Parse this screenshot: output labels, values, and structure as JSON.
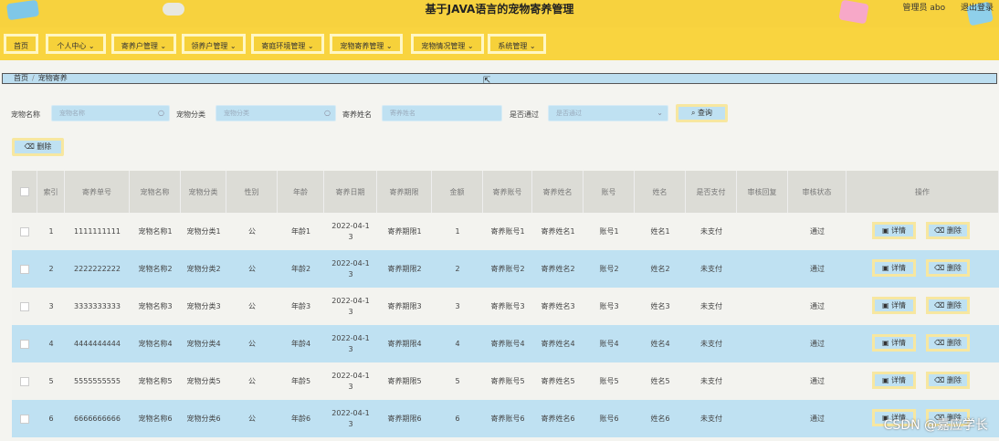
{
  "header": {
    "title": "基于JAVA语言的宠物寄养管理",
    "user": "管理员 abo",
    "logout": "退出登录"
  },
  "nav": [
    "首页",
    "个人中心",
    "寄养户管理",
    "领养户管理",
    "寄庭环境管理",
    "宠物寄养管理",
    "宠物情况管理",
    "系统管理"
  ],
  "breadcrumb": {
    "home": "首页",
    "sep": "/",
    "current": "宠物寄养"
  },
  "search": {
    "fields": [
      {
        "label": "宠物名称",
        "placeholder": "宠物名称"
      },
      {
        "label": "宠物分类",
        "placeholder": "宠物分类"
      },
      {
        "label": "寄养姓名",
        "placeholder": "寄养姓名"
      },
      {
        "label": "是否通过",
        "placeholder": "是否通过"
      }
    ],
    "query_label": "查询",
    "delete_label": "删除"
  },
  "table": {
    "headers": [
      "索引",
      "寄养单号",
      "宠物名称",
      "宠物分类",
      "性别",
      "年龄",
      "寄养日期",
      "寄养期限",
      "金额",
      "寄养账号",
      "寄养姓名",
      "账号",
      "姓名",
      "是否支付",
      "审核回复",
      "审核状态",
      "操作"
    ],
    "rows": [
      [
        "1",
        "1111111111",
        "宠物名称1",
        "宠物分类1",
        "公",
        "年龄1",
        "2022-04-13",
        "寄养期限1",
        "1",
        "寄养账号1",
        "寄养姓名1",
        "账号1",
        "姓名1",
        "未支付",
        "",
        "通过"
      ],
      [
        "2",
        "2222222222",
        "宠物名称2",
        "宠物分类2",
        "公",
        "年龄2",
        "2022-04-13",
        "寄养期限2",
        "2",
        "寄养账号2",
        "寄养姓名2",
        "账号2",
        "姓名2",
        "未支付",
        "",
        "通过"
      ],
      [
        "3",
        "3333333333",
        "宠物名称3",
        "宠物分类3",
        "公",
        "年龄3",
        "2022-04-13",
        "寄养期限3",
        "3",
        "寄养账号3",
        "寄养姓名3",
        "账号3",
        "姓名3",
        "未支付",
        "",
        "通过"
      ],
      [
        "4",
        "4444444444",
        "宠物名称4",
        "宠物分类4",
        "公",
        "年龄4",
        "2022-04-13",
        "寄养期限4",
        "4",
        "寄养账号4",
        "寄养姓名4",
        "账号4",
        "姓名4",
        "未支付",
        "",
        "通过"
      ],
      [
        "5",
        "5555555555",
        "宠物名称5",
        "宠物分类5",
        "公",
        "年龄5",
        "2022-04-13",
        "寄养期限5",
        "5",
        "寄养账号5",
        "寄养姓名5",
        "账号5",
        "姓名5",
        "未支付",
        "",
        "通过"
      ],
      [
        "6",
        "6666666666",
        "宠物名称6",
        "宠物分类6",
        "公",
        "年龄6",
        "2022-04-13",
        "寄养期限6",
        "6",
        "寄养账号6",
        "寄养姓名6",
        "账号6",
        "姓名6",
        "未支付",
        "",
        "通过"
      ]
    ],
    "detail_label": "详情",
    "delete_label": "删除"
  },
  "watermark": "CSDN @嘉应学长",
  "colors": {
    "header_yellow": "#f7d23e",
    "row_blue": "#bfe1f2",
    "button_border": "#f7e7a0"
  }
}
